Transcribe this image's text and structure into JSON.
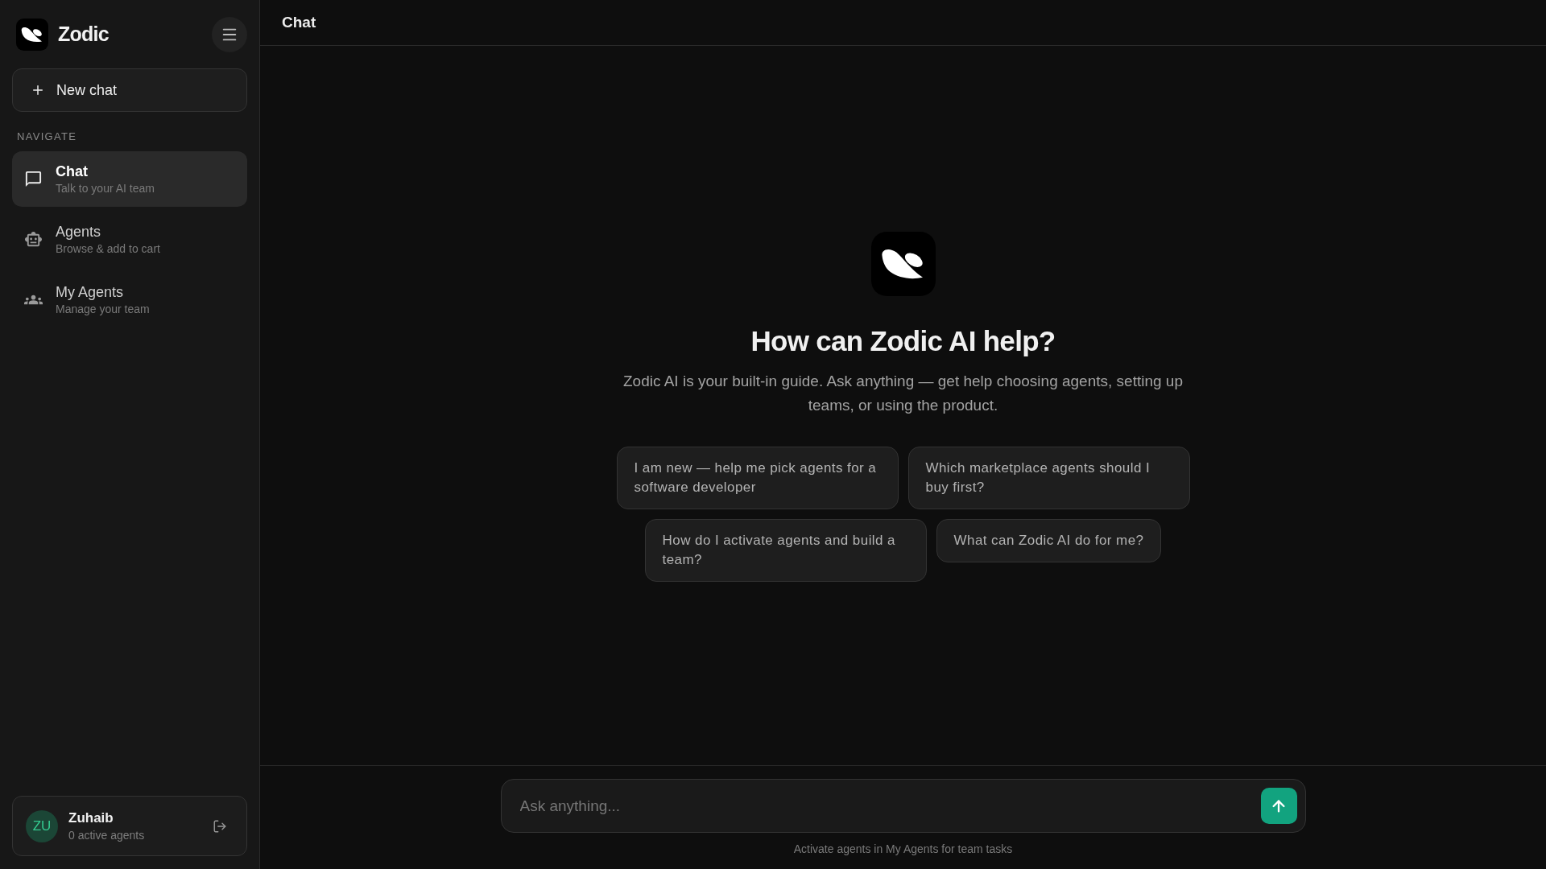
{
  "sidebar": {
    "brand": "Zodic",
    "new_chat": "New chat",
    "section_label": "NAVIGATE",
    "items": [
      {
        "kind": "chat",
        "title": "Chat",
        "subtitle": "Talk to your AI team",
        "selected": true
      },
      {
        "kind": "agents",
        "title": "Agents",
        "subtitle": "Browse & add to cart",
        "selected": false
      },
      {
        "kind": "team",
        "title": "My Agents",
        "subtitle": "Manage your team",
        "selected": false
      }
    ],
    "user": {
      "initials": "ZU",
      "name": "Zuhaib",
      "status": "0 active agents"
    }
  },
  "header": {
    "title": "Chat"
  },
  "welcome": {
    "heading": "How can Zodic AI help?",
    "description": "Zodic AI is your built-in guide. Ask anything — get help choosing agents, setting up teams, or using the product.",
    "suggestions": [
      "I am new — help me pick agents for a software developer",
      "Which marketplace agents should I buy first?",
      "How do I activate agents and build a team?",
      "What can Zodic AI do for me?"
    ]
  },
  "composer": {
    "placeholder": "Ask anything...",
    "hint": "Activate agents in My Agents for team tasks"
  }
}
